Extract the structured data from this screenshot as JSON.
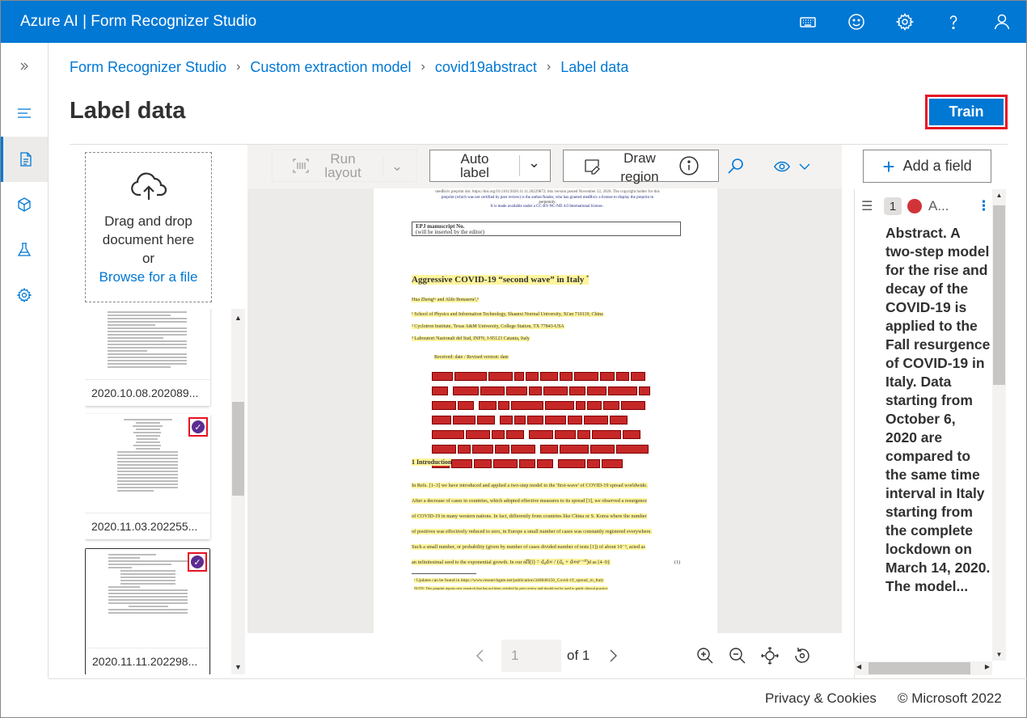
{
  "app": {
    "title": "Azure AI | Form Recognizer Studio"
  },
  "topbar_icons": [
    "keyboard-icon",
    "smiley-icon",
    "gear-icon",
    "help-icon",
    "person-icon"
  ],
  "breadcrumb": [
    "Form Recognizer Studio",
    "Custom extraction model",
    "covid19abstract",
    "Label data"
  ],
  "page": {
    "title": "Label data",
    "train_label": "Train"
  },
  "dropzone": {
    "line1": "Drag and drop",
    "line2": "document here",
    "line3": "or",
    "link": "Browse for a file"
  },
  "documents": [
    {
      "name": "2020.10.08.202089...",
      "checked": false
    },
    {
      "name": "2020.11.03.202255...",
      "checked": true
    },
    {
      "name": "2020.11.11.202298...",
      "checked": true,
      "selected": true
    }
  ],
  "toolbar": {
    "run_layout_1": "Run",
    "run_layout_2": "layout",
    "auto_label_1": "Auto",
    "auto_label_2": "label",
    "draw_region_1": "Draw",
    "draw_region_2": "region"
  },
  "document": {
    "header_1": "medRxiv preprint doi: https://doi.org/10.1101/2020.11.11.20229872; this version posted November 22, 2020. The copyright holder for this",
    "header_2": "preprint (which was not certified by peer review) is the author/funder, who has granted medRxiv a license to display the preprint in",
    "header_3": "perpetuity.",
    "header_4": "It is made available under a CC-BY-NC-ND 4.0 International license .",
    "ms_1": "EPJ manuscript No.",
    "ms_2": "(will be inserted by the editor)",
    "title": "Aggressive COVID-19 “second wave” in Italy",
    "title_mark": "*",
    "authors": "Hua Zheng¹ᵃ and Aldo Bonasera²,³",
    "aff1": "¹ School of Physics and Information Technology, Shaanxi Normal University, Xi'an 710119, China",
    "aff2": "² Cyclotron Institute, Texas A&M University, College Station, TX 77843-USA",
    "aff3": "³ Laboratori Nazionali del Sud, INFN, I-95123 Catania, Italy",
    "received": "Received: date / Revised version: date",
    "intro": "1 Introduction",
    "p1": "In Refs. [1–3] we have introduced and applied a two-step model to the 'first-wave' of COVID-19 spread worldwide.",
    "p2": "After a decrease of cases in countries, which adopted effective measures to its spread [3], we observed a resurgence",
    "p3": "of COVID-19 in many western nations. In fact, differently from countries like China or S. Korea where the number",
    "p4": "of positives was effectively reduced to zero, in Europe a small number of cases was constantly registered everywhere.",
    "p5": "Such a small number, or probability (given by number of cases divided number of tests [1]) of about 10⁻³, acted as",
    "p6": "an infinitesimal seed to the exponential growth. In our model probabilities are described as [4–9]:",
    "eq": "Π(t) = d₀d∞ / (d₀ + d∞eᵗ⁻ᵗ⁰)",
    "eqn": "(1)",
    "fn1": "ᵃ Updates can be found in https://www.researchgate.net/publication/340848156_Covid-19_spread_in_Italy",
    "fn2": "NOTE: This preprint reports new research that has not been certified by peer review and should not be used to guide clinical practice."
  },
  "pager": {
    "current": "1",
    "of_label": "of 1"
  },
  "right_panel": {
    "add_field": "Add a field",
    "field_index": "1",
    "field_name": "A...",
    "field_color": "#d13438",
    "field_value": "Abstract. A two-step model for the rise and decay of the COVID-19 is applied to the Fall resurgence of COVID-19 in Italy. Data starting from October 6, 2020 are compared to the same time interval in Italy starting from the complete lockdown on March 14, 2020. The model..."
  },
  "footer": {
    "privacy": "Privacy & Cookies",
    "copyright": "© Microsoft 2022"
  },
  "colors": {
    "accent": "#0078d4",
    "highlight_border": "#e81123",
    "check": "#5c2d91"
  }
}
